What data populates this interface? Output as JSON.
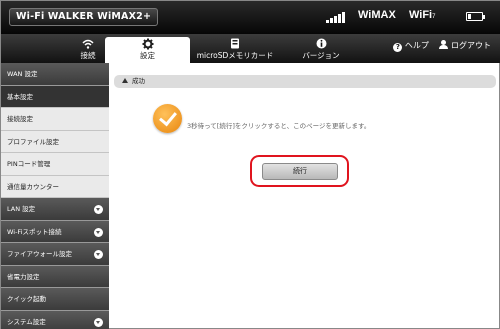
{
  "brand": "Wi-Fi WALKER WiMAX2+",
  "status": {
    "network": "WiMAX",
    "wifi": "WiFi",
    "wifi_sub": "7",
    "icons": [
      "signal-icon",
      "battery-icon"
    ]
  },
  "tabs": [
    {
      "label": "接続",
      "icon": "wifi-icon"
    },
    {
      "label": "設定",
      "icon": "gear-icon",
      "active": true
    },
    {
      "label": "microSDメモリカード",
      "icon": "sd-card-icon"
    },
    {
      "label": "バージョン",
      "icon": "info-icon"
    }
  ],
  "top_links": {
    "help": "ヘルプ",
    "logout": "ログアウト"
  },
  "sidebar": {
    "items": [
      {
        "label": "WAN 設定",
        "style": "dark"
      },
      {
        "label": "基本設定",
        "style": "darkest"
      },
      {
        "label": "接続設定",
        "style": "light"
      },
      {
        "label": "プロファイル設定",
        "style": "light"
      },
      {
        "label": "PINコード管理",
        "style": "light"
      },
      {
        "label": "通信量カウンター",
        "style": "light"
      },
      {
        "label": "LAN 設定",
        "style": "dark",
        "expandable": true
      },
      {
        "label": "Wi-Fiスポット接続",
        "style": "dark",
        "expandable": true
      },
      {
        "label": "ファイアウォール設定",
        "style": "dark",
        "expandable": true
      },
      {
        "label": "省電力設定",
        "style": "dark"
      },
      {
        "label": "クイック起動",
        "style": "dark"
      },
      {
        "label": "システム設定",
        "style": "dark",
        "expandable": true
      }
    ]
  },
  "main": {
    "section_title": "成功",
    "message": "3秒待って[続行]をクリックすると、このページを更新します。",
    "continue_label": "続行",
    "highlight_color": "#e0141e",
    "success_color": "#f0a030"
  }
}
